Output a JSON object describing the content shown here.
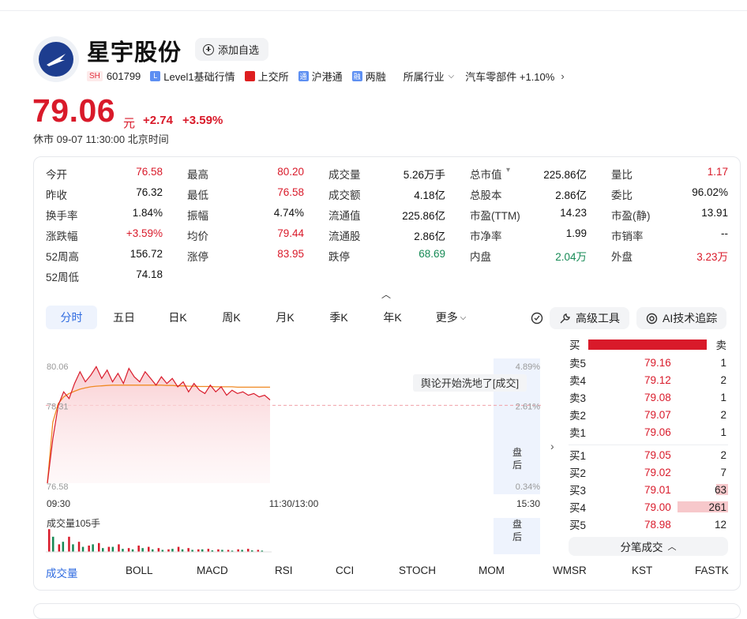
{
  "stock": {
    "name": "星宇股份",
    "market": "SH",
    "code": "601799",
    "level": "Level1基础行情",
    "exchange": "上交所",
    "connect": "沪港通",
    "margin": "两融",
    "industry_label": "所属行业",
    "sector": "汽车零部件 +1.10%",
    "add_fav": "添加自选",
    "price": "79.06",
    "price_unit": "元",
    "change": "+2.74",
    "change_pct": "+3.59%",
    "status": "休市  09-07 11:30:00 北京时间"
  },
  "stats": [
    {
      "label": "今开",
      "value": "76.58",
      "color": "red"
    },
    {
      "label": "最高",
      "value": "80.20",
      "color": "red"
    },
    {
      "label": "成交量",
      "value": "5.26万手",
      "color": ""
    },
    {
      "label": "总市值",
      "value": "225.86亿",
      "color": ""
    },
    {
      "label": "量比",
      "value": "1.17",
      "color": "red"
    },
    {
      "label": "昨收",
      "value": "76.32",
      "color": ""
    },
    {
      "label": "最低",
      "value": "76.58",
      "color": "red"
    },
    {
      "label": "成交额",
      "value": "4.18亿",
      "color": ""
    },
    {
      "label": "总股本",
      "value": "2.86亿",
      "color": ""
    },
    {
      "label": "委比",
      "value": "96.02%",
      "color": ""
    },
    {
      "label": "换手率",
      "value": "1.84%",
      "color": ""
    },
    {
      "label": "振幅",
      "value": "4.74%",
      "color": ""
    },
    {
      "label": "流通值",
      "value": "225.86亿",
      "color": ""
    },
    {
      "label": "市盈(TTM)",
      "value": "14.23",
      "color": ""
    },
    {
      "label": "市盈(静)",
      "value": "13.91",
      "color": ""
    },
    {
      "label": "涨跌幅",
      "value": "+3.59%",
      "color": "red"
    },
    {
      "label": "均价",
      "value": "79.44",
      "color": "red"
    },
    {
      "label": "流通股",
      "value": "2.86亿",
      "color": ""
    },
    {
      "label": "市净率",
      "value": "1.99",
      "color": ""
    },
    {
      "label": "市销率",
      "value": "--",
      "color": ""
    },
    {
      "label": "52周高",
      "value": "156.72",
      "color": ""
    },
    {
      "label": "涨停",
      "value": "83.95",
      "color": "red"
    },
    {
      "label": "跌停",
      "value": "68.69",
      "color": "green"
    },
    {
      "label": "内盘",
      "value": "2.04万",
      "color": "green"
    },
    {
      "label": "外盘",
      "value": "3.23万",
      "color": "red"
    },
    {
      "label": "52周低",
      "value": "74.18",
      "color": ""
    }
  ],
  "tabs": [
    "分时",
    "五日",
    "日K",
    "周K",
    "月K",
    "季K",
    "年K",
    "更多"
  ],
  "tools": {
    "advanced": "高级工具",
    "ai": "AI技术追踪"
  },
  "order_book": {
    "buy_label": "买",
    "sell_label": "卖",
    "asks": [
      {
        "label": "卖5",
        "price": "79.16",
        "vol": "1"
      },
      {
        "label": "卖4",
        "price": "79.12",
        "vol": "2"
      },
      {
        "label": "卖3",
        "price": "79.08",
        "vol": "1"
      },
      {
        "label": "卖2",
        "price": "79.07",
        "vol": "2"
      },
      {
        "label": "卖1",
        "price": "79.06",
        "vol": "1"
      }
    ],
    "bids": [
      {
        "label": "买1",
        "price": "79.05",
        "vol": "2"
      },
      {
        "label": "买2",
        "price": "79.02",
        "vol": "7"
      },
      {
        "label": "买3",
        "price": "79.01",
        "vol": "63"
      },
      {
        "label": "买4",
        "price": "79.00",
        "vol": "261"
      },
      {
        "label": "买5",
        "price": "78.98",
        "vol": "12"
      }
    ],
    "trades_btn": "分笔成交"
  },
  "indicators": [
    "成交量",
    "BOLL",
    "MACD",
    "RSI",
    "CCI",
    "STOCH",
    "MOM",
    "WMSR",
    "KST",
    "FASTK"
  ],
  "colors": {
    "up": "#d91a2a",
    "down": "#168a55",
    "accent": "#2f6be0",
    "avg_line": "#f08a24"
  },
  "chart_data": {
    "type": "line",
    "price_axis": [
      "80.06",
      "78.31",
      "76.58"
    ],
    "pct_axis": [
      "4.89%",
      "2.61%",
      "0.34%"
    ],
    "time_axis": [
      "09:30",
      "11:30/13:00",
      "15:30"
    ],
    "after_hours_label": "盘后",
    "volume_label": "成交量105手",
    "news_tag": "舆论开始洗地了[成交]",
    "ylim": [
      76.58,
      80.06
    ],
    "prev_close": 78.31,
    "price": [
      76.58,
      77.9,
      78.9,
      79.3,
      79.1,
      79.55,
      79.9,
      79.6,
      79.8,
      80.05,
      79.7,
      79.95,
      79.6,
      79.85,
      79.55,
      80.0,
      79.75,
      79.6,
      79.9,
      79.7,
      79.5,
      79.75,
      79.55,
      79.7,
      79.45,
      79.6,
      79.3,
      79.55,
      79.35,
      79.25,
      79.5,
      79.3,
      79.45,
      79.2,
      79.35,
      79.25,
      79.3,
      79.2,
      79.25,
      79.15,
      79.2,
      79.06
    ],
    "avg": [
      76.58,
      78.4,
      78.95,
      79.15,
      79.25,
      79.32,
      79.38,
      79.42,
      79.45,
      79.47,
      79.48,
      79.49,
      79.5,
      79.5,
      79.5,
      79.5,
      79.5,
      79.5,
      79.5,
      79.5,
      79.5,
      79.5,
      79.49,
      79.49,
      79.48,
      79.48,
      79.47,
      79.47,
      79.46,
      79.46,
      79.46,
      79.45,
      79.45,
      79.45,
      79.45,
      79.44,
      79.44,
      79.44,
      79.44,
      79.44,
      79.44,
      79.44
    ],
    "volume_up": [
      0.9,
      0.3,
      0.6,
      0.4,
      0.25,
      0.35,
      0.2,
      0.3,
      0.15,
      0.25,
      0.2,
      0.15,
      0.1,
      0.2,
      0.15,
      0.1,
      0.12,
      0.1,
      0.08,
      0.1,
      0.12,
      0.08
    ],
    "volume_down": [
      0.6,
      0.4,
      0.3,
      0.2,
      0.3,
      0.15,
      0.2,
      0.12,
      0.1,
      0.15,
      0.1,
      0.08,
      0.12,
      0.1,
      0.08,
      0.1,
      0.06,
      0.08,
      0.05,
      0.08,
      0.06,
      0.05
    ]
  }
}
